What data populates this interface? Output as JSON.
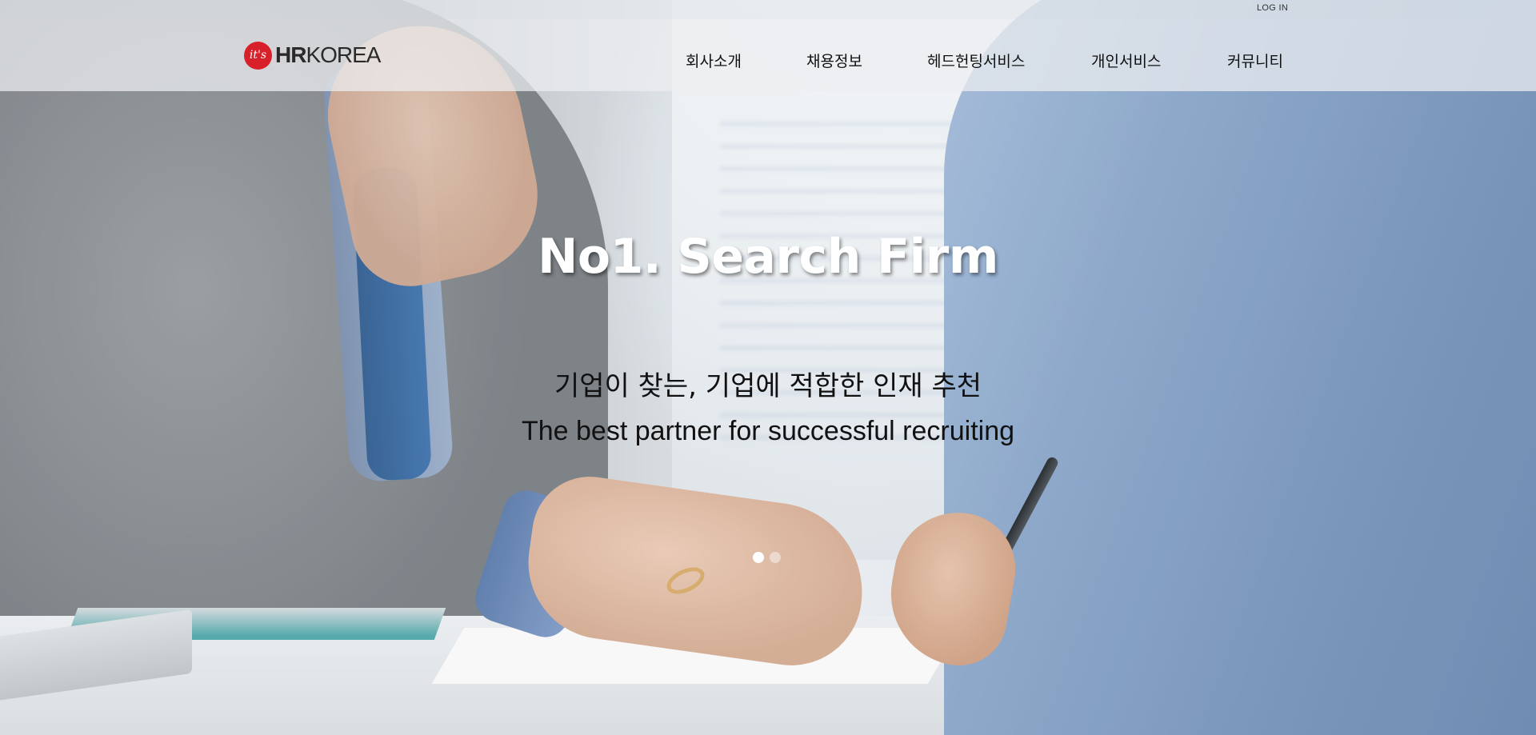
{
  "top_bar": {
    "login_label": "LOG IN"
  },
  "header": {
    "logo": {
      "mark_text": "it's",
      "brand_bold": "HR",
      "brand_regular": "KOREA",
      "mark_color": "#d8202a"
    },
    "nav": [
      {
        "label": "회사소개"
      },
      {
        "label": "채용정보"
      },
      {
        "label": "헤드헌팅서비스"
      },
      {
        "label": "개인서비스"
      },
      {
        "label": "커뮤니티"
      }
    ]
  },
  "hero": {
    "title": "No1. Search Firm",
    "subtitle_kr": "기업이 찾는, 기업에 적합한 인재 추천",
    "subtitle_en": "The best partner for successful recruiting",
    "slider": {
      "slide_count": 2,
      "active_index": 0
    }
  }
}
